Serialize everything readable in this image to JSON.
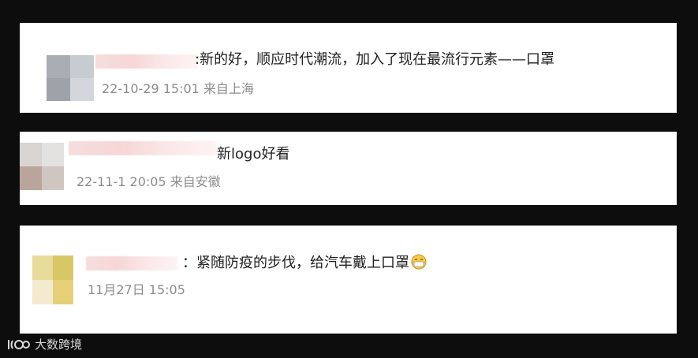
{
  "comments": [
    {
      "text": ":新的好，顺应时代潮流，加入了现在最流行元素——口罩",
      "date": "22-10-29 15:01",
      "location": "来自上海"
    },
    {
      "text": "新logo好看",
      "date": "22-11-1 20:05",
      "location": "来自安徽"
    },
    {
      "text": "：紧随防疫的步伐，给汽车戴上口罩",
      "emoji": "mask-emoji",
      "date": "11月27日 15:05",
      "location": ""
    }
  ],
  "watermark": {
    "brand": "大数跨境"
  }
}
